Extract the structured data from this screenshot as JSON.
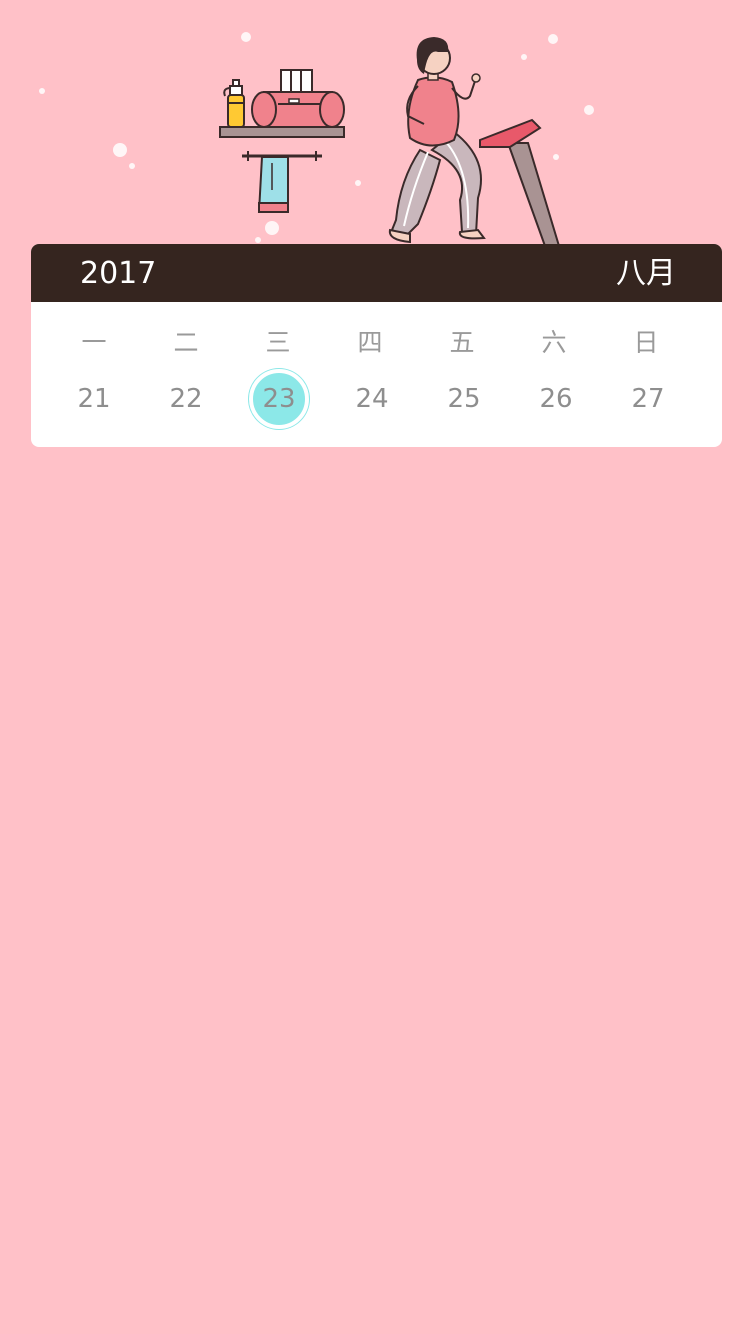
{
  "colors": {
    "background": "#FFC1C8",
    "header_background": "#35251F",
    "card_background": "#FFFFFF",
    "selected_day": "#8CE8E8",
    "text_muted": "#8E8E8E"
  },
  "illustration": {
    "icons": [
      "treadmill-runner-icon",
      "water-bottle-icon",
      "foam-roller-icon",
      "towel-icon"
    ]
  },
  "calendar": {
    "year": "2017",
    "month": "八月",
    "weekdays": [
      "一",
      "二",
      "三",
      "四",
      "五",
      "六",
      "日"
    ],
    "days": [
      "21",
      "22",
      "23",
      "24",
      "25",
      "26",
      "27"
    ],
    "selected_day": "23"
  }
}
